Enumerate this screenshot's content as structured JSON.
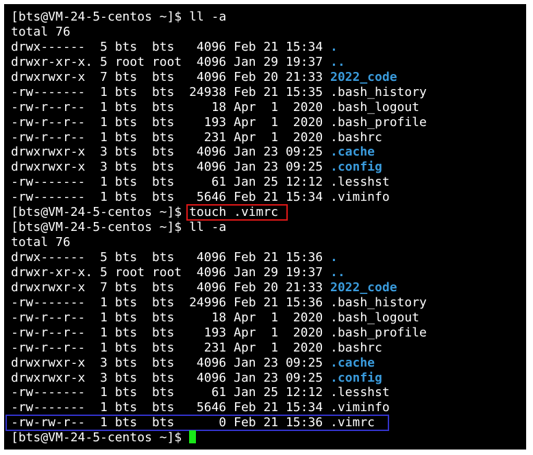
{
  "prompt": "[bts@VM-24-5-centos ~]$ ",
  "commands": {
    "first": "ll -a",
    "touch": "touch .vimrc",
    "second": "ll -a"
  },
  "listing1": {
    "total": "total 76",
    "rows": [
      {
        "prefix": "drwx------  5 bts  bts   4096 Feb 21 15:34 ",
        "name": ".",
        "type": "dir"
      },
      {
        "prefix": "drwxr-xr-x. 5 root root  4096 Jan 29 19:37 ",
        "name": "..",
        "type": "dir"
      },
      {
        "prefix": "drwxrwxr-x  7 bts  bts   4096 Feb 20 21:33 ",
        "name": "2022_code",
        "type": "dir"
      },
      {
        "prefix": "-rw-------  1 bts  bts  24938 Feb 21 15:35 ",
        "name": ".bash_history",
        "type": "file"
      },
      {
        "prefix": "-rw-r--r--  1 bts  bts     18 Apr  1  2020 ",
        "name": ".bash_logout",
        "type": "file"
      },
      {
        "prefix": "-rw-r--r--  1 bts  bts    193 Apr  1  2020 ",
        "name": ".bash_profile",
        "type": "file"
      },
      {
        "prefix": "-rw-r--r--  1 bts  bts    231 Apr  1  2020 ",
        "name": ".bashrc",
        "type": "file"
      },
      {
        "prefix": "drwxrwxr-x  3 bts  bts   4096 Jan 23 09:25 ",
        "name": ".cache",
        "type": "dir"
      },
      {
        "prefix": "drwxrwxr-x  3 bts  bts   4096 Jan 23 09:25 ",
        "name": ".config",
        "type": "dir"
      },
      {
        "prefix": "-rw-------  1 bts  bts     61 Jan 25 12:12 ",
        "name": ".lesshst",
        "type": "file"
      },
      {
        "prefix": "-rw-------  1 bts  bts   5646 Feb 21 15:34 ",
        "name": ".viminfo",
        "type": "file"
      }
    ]
  },
  "listing2": {
    "total": "total 76",
    "rows": [
      {
        "prefix": "drwx------  5 bts  bts   4096 Feb 21 15:36 ",
        "name": ".",
        "type": "dir"
      },
      {
        "prefix": "drwxr-xr-x. 5 root root  4096 Jan 29 19:37 ",
        "name": "..",
        "type": "dir"
      },
      {
        "prefix": "drwxrwxr-x  7 bts  bts   4096 Feb 20 21:33 ",
        "name": "2022_code",
        "type": "dir"
      },
      {
        "prefix": "-rw-------  1 bts  bts  24996 Feb 21 15:36 ",
        "name": ".bash_history",
        "type": "file"
      },
      {
        "prefix": "-rw-r--r--  1 bts  bts     18 Apr  1  2020 ",
        "name": ".bash_logout",
        "type": "file"
      },
      {
        "prefix": "-rw-r--r--  1 bts  bts    193 Apr  1  2020 ",
        "name": ".bash_profile",
        "type": "file"
      },
      {
        "prefix": "-rw-r--r--  1 bts  bts    231 Apr  1  2020 ",
        "name": ".bashrc",
        "type": "file"
      },
      {
        "prefix": "drwxrwxr-x  3 bts  bts   4096 Jan 23 09:25 ",
        "name": ".cache",
        "type": "dir"
      },
      {
        "prefix": "drwxrwxr-x  3 bts  bts   4096 Jan 23 09:25 ",
        "name": ".config",
        "type": "dir"
      },
      {
        "prefix": "-rw-------  1 bts  bts     61 Jan 25 12:12 ",
        "name": ".lesshst",
        "type": "file"
      },
      {
        "prefix": "-rw-------  1 bts  bts   5646 Feb 21 15:34 ",
        "name": ".viminfo",
        "type": "file"
      },
      {
        "prefix": "-rw-rw-r--  1 bts  bts      0 Feb 21 15:36 ",
        "name": ".vimrc",
        "type": "file",
        "highlight": true
      }
    ]
  },
  "colors": {
    "background": "#000000",
    "text": "#ffffff",
    "directory": "#3a9bdc",
    "cursor": "#19e619",
    "command_highlight": "#e01818",
    "row_highlight": "#3333cc"
  },
  "icons": {
    "cursor": "block-cursor-icon"
  }
}
